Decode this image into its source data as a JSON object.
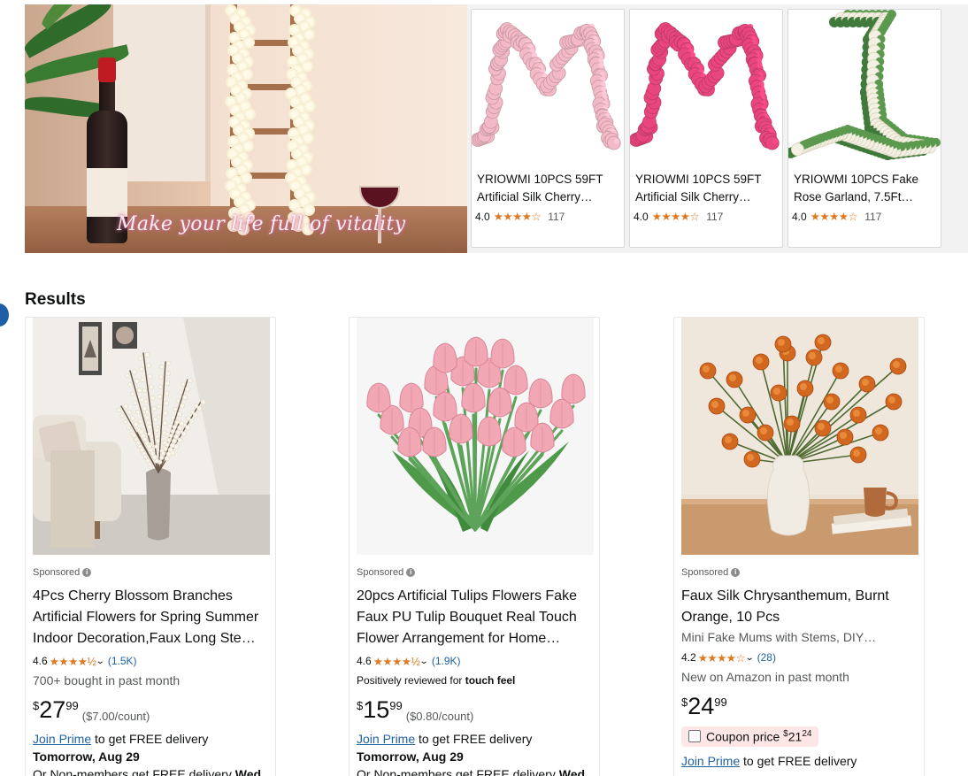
{
  "banner": {
    "caption": "Make your life full of vitality",
    "products": [
      {
        "title": "YRIOWMI 10PCS 59FT Artificial Silk Cherry…",
        "rating": "4.0",
        "stars": "★★★★☆",
        "count": "117",
        "color": "#f3b9c6"
      },
      {
        "title": "YRIOWMI 10PCS 59FT Artificial Silk Cherry…",
        "rating": "4.0",
        "stars": "★★★★☆",
        "count": "117",
        "color": "#e9467f"
      },
      {
        "title": "YRIOWMI 10PCS Fake Rose Garland, 7.5Ft…",
        "rating": "4.0",
        "stars": "★★★★☆",
        "count": "117",
        "color": "#f4f1e4"
      }
    ]
  },
  "results": {
    "heading": "Results",
    "items": [
      {
        "sponsored": "Sponsored",
        "title": "4Pcs Cherry Blossom Branches Artificial Flowers for Spring Summer Indoor Decoration,Faux Long Ste…",
        "rating": "4.6",
        "stars": "★★★★½",
        "reviews": "(1.5K)",
        "social": "700+ bought in past month",
        "price_symbol": "$",
        "price_whole": "27",
        "price_fraction": "99",
        "unit_price": "($7.00/count)",
        "join_prime": "Join Prime",
        "delivery_text": " to get FREE delivery",
        "delivery_date": "Tomorrow, Aug 29",
        "nonmember_text": "Or Non-members get FREE delivery ",
        "nonmember_day": "Wed,"
      },
      {
        "sponsored": "Sponsored",
        "title": "20pcs Artificial Tulips Flowers Fake Faux PU Tulip Bouquet Real Touch Flower Arrangement for Home…",
        "rating": "4.6",
        "stars": "★★★★½",
        "reviews": "(1.9K)",
        "social_prefix": "Positively reviewed for ",
        "social_bold": "touch feel",
        "price_symbol": "$",
        "price_whole": "15",
        "price_fraction": "99",
        "unit_price": "($0.80/count)",
        "join_prime": "Join Prime",
        "delivery_text": " to get FREE delivery",
        "delivery_date": "Tomorrow, Aug 29",
        "nonmember_text": "Or Non-members get FREE delivery ",
        "nonmember_day": "Wed,"
      },
      {
        "sponsored": "Sponsored",
        "title": "Faux Silk Chrysanthemum, Burnt Orange, 10 Pcs",
        "subtitle": "Mini Fake Mums with Stems, DIY…",
        "rating": "4.2",
        "stars": "★★★★☆",
        "reviews": "(28)",
        "social": "New on Amazon in past month",
        "price_symbol": "$",
        "price_whole": "24",
        "price_fraction": "99",
        "coupon_label": "Coupon price ",
        "coupon_symbol": "$",
        "coupon_whole": "21",
        "coupon_fraction": "24",
        "join_prime": "Join Prime",
        "delivery_text": " to get FREE delivery"
      }
    ]
  }
}
